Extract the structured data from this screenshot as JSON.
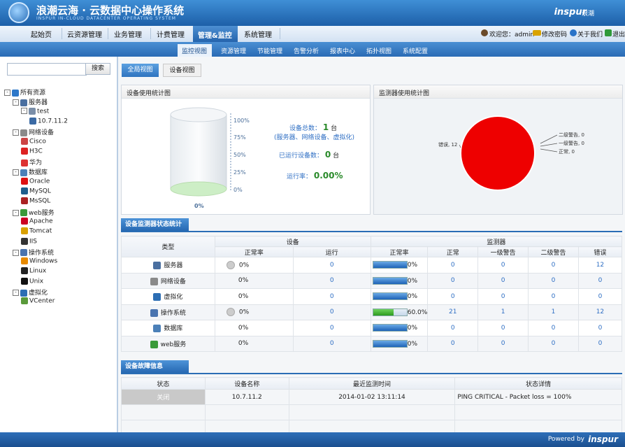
{
  "header": {
    "title": "浪潮云海 · 云数据中心操作系统",
    "subtitle": "INSPUR IN-CLOUD DATACENTER OPERATING SYSTEM",
    "brand": "inspur",
    "brand_cn": "浪潮"
  },
  "nav1": {
    "items": [
      "起始页",
      "云资源管理",
      "业务管理",
      "计费管理",
      "管理&监控",
      "系统管理"
    ],
    "active": "管理&监控",
    "user_label": "欢迎您：admin",
    "change_password": "修改密码",
    "about": "关于我们",
    "logout": "退出"
  },
  "nav2": {
    "items": [
      "监控视图",
      "资源管理",
      "节能管理",
      "告警分析",
      "报表中心",
      "拓扑视图",
      "系统配置"
    ],
    "active": "监控视图"
  },
  "sidebar": {
    "search_placeholder": "",
    "search_button": "搜索",
    "tree": [
      {
        "label": "所有资源",
        "level": 0,
        "expand": "⊟",
        "icon": "globe-icon"
      },
      {
        "label": "服务器",
        "level": 1,
        "expand": "⊟",
        "icon": "server-icon"
      },
      {
        "label": "test",
        "level": 2,
        "expand": "⊟",
        "icon": "cluster-icon"
      },
      {
        "label": "10.7.11.2",
        "level": 3,
        "expand": "",
        "icon": "host-icon"
      },
      {
        "label": "网络设备",
        "level": 1,
        "expand": "⊟",
        "icon": "network-icon"
      },
      {
        "label": "Cisco",
        "level": 2,
        "expand": "",
        "icon": "cisco-icon"
      },
      {
        "label": "H3C",
        "level": 2,
        "expand": "",
        "icon": "h3c-icon"
      },
      {
        "label": "华为",
        "level": 2,
        "expand": "",
        "icon": "huawei-icon"
      },
      {
        "label": "数据库",
        "level": 1,
        "expand": "⊟",
        "icon": "database-icon"
      },
      {
        "label": "Oracle",
        "level": 2,
        "expand": "",
        "icon": "oracle-icon"
      },
      {
        "label": "MySQL",
        "level": 2,
        "expand": "",
        "icon": "mysql-icon"
      },
      {
        "label": "MsSQL",
        "level": 2,
        "expand": "",
        "icon": "mssql-icon"
      },
      {
        "label": "web服务",
        "level": 1,
        "expand": "⊟",
        "icon": "web-icon"
      },
      {
        "label": "Apache",
        "level": 2,
        "expand": "",
        "icon": "apache-icon"
      },
      {
        "label": "Tomcat",
        "level": 2,
        "expand": "",
        "icon": "tomcat-icon"
      },
      {
        "label": "IIS",
        "level": 2,
        "expand": "",
        "icon": "iis-icon"
      },
      {
        "label": "操作系统",
        "level": 1,
        "expand": "⊟",
        "icon": "os-icon"
      },
      {
        "label": "Windows",
        "level": 2,
        "expand": "",
        "icon": "windows-icon"
      },
      {
        "label": "Linux",
        "level": 2,
        "expand": "",
        "icon": "linux-icon"
      },
      {
        "label": "Unix",
        "level": 2,
        "expand": "",
        "icon": "unix-icon"
      },
      {
        "label": "虚拟化",
        "level": 1,
        "expand": "⊟",
        "icon": "virtualization-icon"
      },
      {
        "label": "VCenter",
        "level": 2,
        "expand": "",
        "icon": "vcenter-icon"
      }
    ]
  },
  "main": {
    "tabs": [
      "全局视图",
      "设备视图"
    ],
    "device_panel": {
      "title": "设备使用统计图",
      "ticks": [
        "100%",
        "75%",
        "50%",
        "25%",
        "0%"
      ],
      "bottom_label": "0%",
      "total_label": "设备总数：",
      "total_value": "1",
      "total_unit": "台",
      "total_note": "(服务器、网络设备、虚拟化)",
      "running_label": "已运行设备数：",
      "running_value": "0",
      "running_unit": "台",
      "rate_label": "运行率：",
      "rate_value": "0.00%"
    },
    "monitor_panel": {
      "title": "监测器使用统计图",
      "chart_data": {
        "type": "pie",
        "categories": [
          "错误",
          "二级警告",
          "一级警告",
          "正常"
        ],
        "values": [
          12,
          0,
          0,
          0
        ],
        "labels": [
          "错误, 12",
          "二级警告, 0",
          "一级警告, 0",
          "正常, 0"
        ],
        "colors": [
          "#ee0000",
          "#c8b400",
          "#3b8a2a",
          "#2c69c7"
        ]
      }
    },
    "status_section": {
      "title": "设备监测器状态统计",
      "header_type": "类型",
      "header_device": "设备",
      "header_monitor": "监测器",
      "subheaders": [
        "正常率",
        "运行",
        "正常率",
        "正常",
        "一级警告",
        "二级警告",
        "错误"
      ],
      "rows": [
        {
          "name": "服务器",
          "icon": "server-icon",
          "dev_rate": "0%",
          "dev_dot": true,
          "running": "0",
          "mon_rate": "0%",
          "mon_fill": 0,
          "normal": "0",
          "w1": "0",
          "w2": "0",
          "err": "12"
        },
        {
          "name": "网络设备",
          "icon": "network-icon",
          "dev_rate": "0%",
          "dev_dot": false,
          "running": "0",
          "mon_rate": "0%",
          "mon_fill": 0,
          "normal": "0",
          "w1": "0",
          "w2": "0",
          "err": "0"
        },
        {
          "name": "虚拟化",
          "icon": "virtualization-icon",
          "dev_rate": "0%",
          "dev_dot": false,
          "running": "0",
          "mon_rate": "0%",
          "mon_fill": 0,
          "normal": "0",
          "w1": "0",
          "w2": "0",
          "err": "0"
        },
        {
          "name": "操作系统",
          "icon": "os-icon",
          "dev_rate": "0%",
          "dev_dot": true,
          "running": "0",
          "mon_rate": "60.0%",
          "mon_fill": 0.6,
          "normal": "21",
          "w1": "1",
          "w2": "1",
          "err": "12"
        },
        {
          "name": "数据库",
          "icon": "database-icon",
          "dev_rate": "0%",
          "dev_dot": false,
          "running": "0",
          "mon_rate": "0%",
          "mon_fill": 0,
          "normal": "0",
          "w1": "0",
          "w2": "0",
          "err": "0"
        },
        {
          "name": "web服务",
          "icon": "web-icon",
          "dev_rate": "0%",
          "dev_dot": false,
          "running": "0",
          "mon_rate": "0%",
          "mon_fill": 0,
          "normal": "0",
          "w1": "0",
          "w2": "0",
          "err": "0"
        }
      ]
    },
    "fault_section": {
      "title": "设备故障信息",
      "headers": [
        "状态",
        "设备名称",
        "最近监测时间",
        "状态详情"
      ],
      "rows": [
        {
          "status": "关闭",
          "device": "10.7.11.2",
          "time": "2014-01-02 13:11:14",
          "detail": "PING CRITICAL - Packet loss = 100%"
        }
      ]
    }
  },
  "footer": {
    "powered_by": "Powered by",
    "brand": "inspur"
  }
}
